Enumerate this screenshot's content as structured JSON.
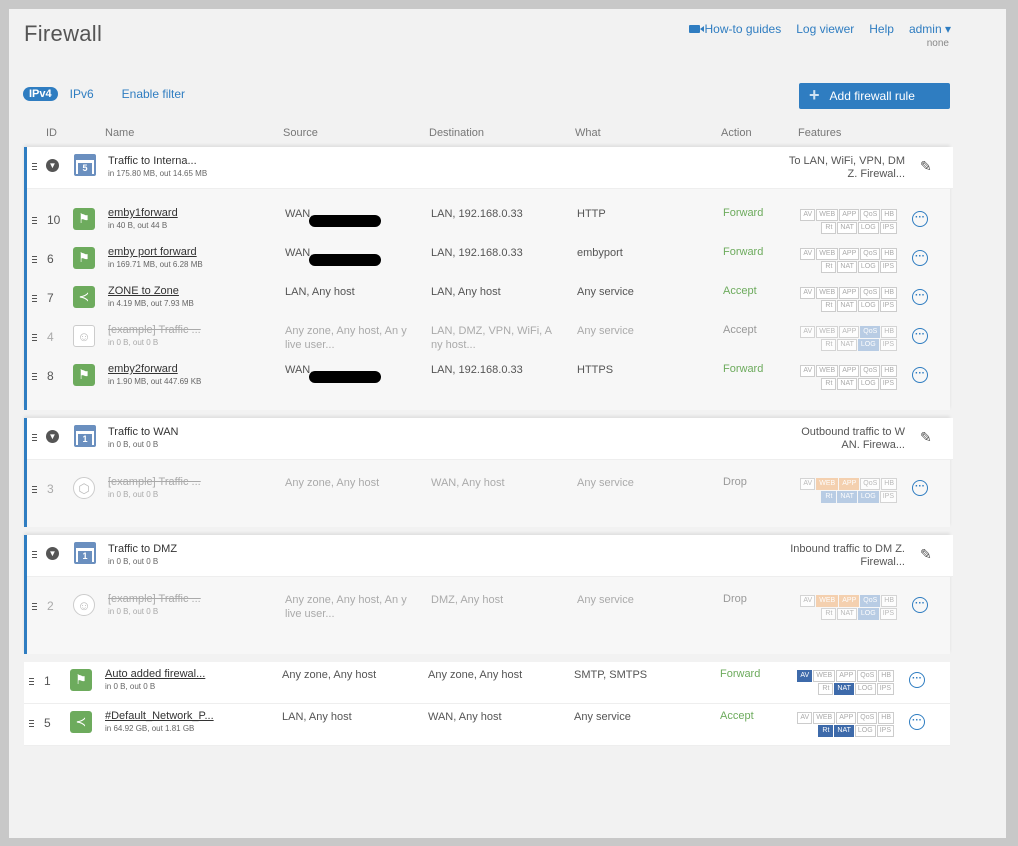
{
  "page": {
    "title": "Firewall"
  },
  "nav": {
    "guides": "How-to guides",
    "log": "Log viewer",
    "help": "Help",
    "user": "admin ▾",
    "user_sub": "none"
  },
  "tabs": {
    "ipv4": "IPv4",
    "ipv6": "IPv6",
    "filter": "Enable filter"
  },
  "add_button": {
    "label": "Add firewall rule",
    "icon": "+"
  },
  "columns": {
    "id": "ID",
    "name": "Name",
    "source": "Source",
    "destination": "Destination",
    "what": "What",
    "action": "Action",
    "features": "Features"
  },
  "groups": [
    {
      "name": "Traffic to Interna...",
      "count": "5",
      "stats": "in 175.80 MB, out 14.65 MB",
      "features": "To LAN, WiFi, VPN, DM Z. Firewal..."
    },
    {
      "name": "Traffic to WAN",
      "count": "1",
      "stats": "in 0 B, out 0 B",
      "features": "Outbound traffic to W AN. Firewa..."
    },
    {
      "name": "Traffic to DMZ",
      "count": "1",
      "stats": "in 0 B, out 0 B",
      "features": "Inbound traffic to DM Z. Firewal..."
    }
  ],
  "rules": [
    {
      "id": "10",
      "name": "emby1forward",
      "stats": "in 40 B, out 44 B",
      "source": "WAN,",
      "destination": "LAN, 192.168.0.33",
      "what": "HTTP",
      "action": "Forward"
    },
    {
      "id": "6",
      "name": "emby port forward",
      "stats": "in 169.71 MB, out 6.28 MB",
      "source": "WAN,",
      "destination": "LAN, 192.168.0.33",
      "what": "embyport",
      "action": "Forward"
    },
    {
      "id": "7",
      "name": "ZONE to Zone",
      "stats": "in 4.19 MB, out 7.93 MB",
      "source": "LAN, Any host",
      "destination": "LAN, Any host",
      "what": "Any service",
      "action": "Accept"
    },
    {
      "id": "4",
      "name": "[example] Traffic ...",
      "stats": "in 0 B, out 0 B",
      "source": "Any zone, Any host, An y live user...",
      "destination": "LAN, DMZ, VPN, WiFi, A ny host...",
      "what": "Any service",
      "action": "Accept"
    },
    {
      "id": "8",
      "name": "emby2forward",
      "stats": "in 1.90 MB, out 447.69 KB",
      "source": "WAN,",
      "destination": "LAN, 192.168.0.33",
      "what": "HTTPS",
      "action": "Forward"
    },
    {
      "id": "3",
      "name": "[example] Traffic ...",
      "stats": "in 0 B, out 0 B",
      "source": "Any zone, Any host",
      "destination": "WAN, Any host",
      "what": "Any service",
      "action": "Drop"
    },
    {
      "id": "2",
      "name": "[example] Traffic ...",
      "stats": "in 0 B, out 0 B",
      "source": "Any zone, Any host, An y live user...",
      "destination": "DMZ, Any host",
      "what": "Any service",
      "action": "Drop"
    },
    {
      "id": "1",
      "name": "Auto added firewal...",
      "stats": "in 0 B, out 0 B",
      "source": "Any zone, Any host",
      "destination": "Any zone, Any host",
      "what": "SMTP, SMTPS",
      "action": "Forward"
    },
    {
      "id": "5",
      "name": "#Default_Network_P...",
      "stats": "in 64.92 GB, out 1.81 GB",
      "source": "LAN, Any host",
      "destination": "WAN, Any host",
      "what": "Any service",
      "action": "Accept"
    }
  ],
  "feature_tags": {
    "av": "AV",
    "web": "WEB",
    "app": "APP",
    "qos": "QoS",
    "hb": "HB",
    "rt": "Rt",
    "nat": "NAT",
    "log": "LOG",
    "ips": "IPS"
  },
  "colors": {
    "accent": "#2f7dc1",
    "forward": "#6dab5d",
    "active_tag": "#3d6aaa"
  }
}
